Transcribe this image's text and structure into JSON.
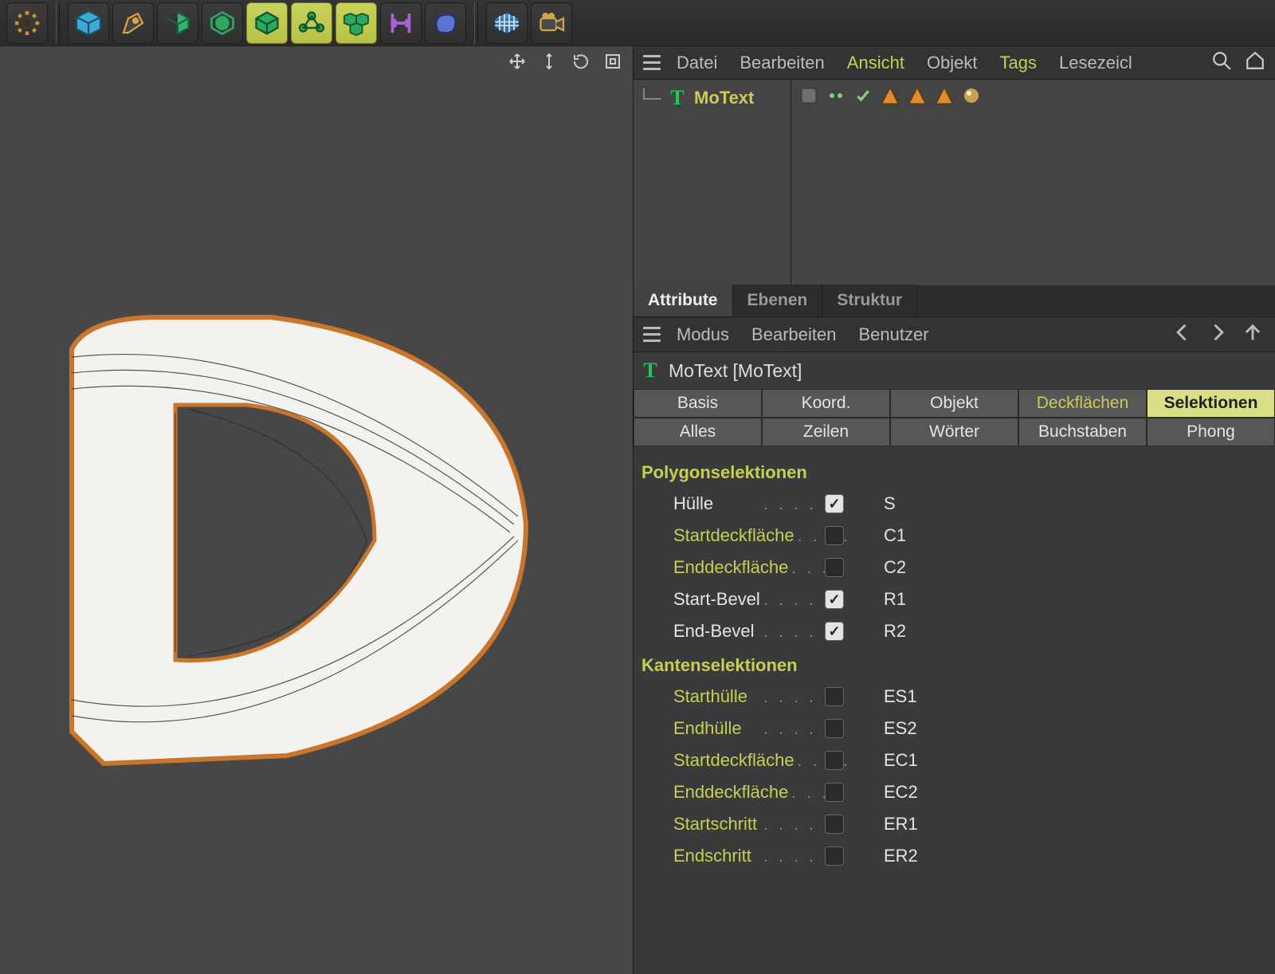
{
  "toolbar_icons": [
    {
      "name": "settings-icon"
    },
    {
      "sep": true
    },
    {
      "name": "cube-icon"
    },
    {
      "name": "pen-icon"
    },
    {
      "name": "spline-wrap-icon"
    },
    {
      "name": "subdiv-cage-icon",
      "sel": false
    },
    {
      "name": "poly-cube-icon",
      "sel": true
    },
    {
      "name": "molecule-icon",
      "sel": true
    },
    {
      "name": "cubes-group-icon",
      "sel": true
    },
    {
      "name": "measure-icon"
    },
    {
      "name": "soft-shape-icon"
    },
    {
      "sep": true
    },
    {
      "name": "grid-icon"
    },
    {
      "name": "camera-icon"
    }
  ],
  "viewport_controls": [
    {
      "name": "move-view-icon"
    },
    {
      "name": "zoom-view-icon"
    },
    {
      "name": "rotate-view-icon"
    },
    {
      "name": "frame-view-icon"
    }
  ],
  "om_menu": [
    {
      "label": "Datei"
    },
    {
      "label": "Bearbeiten"
    },
    {
      "label": "Ansicht",
      "active": true
    },
    {
      "label": "Objekt"
    },
    {
      "label": "Tags",
      "active": true
    },
    {
      "label": "Lesezeicl"
    }
  ],
  "om_object": {
    "name": "MoText"
  },
  "panel_tabs": [
    {
      "label": "Attribute",
      "on": true
    },
    {
      "label": "Ebenen"
    },
    {
      "label": "Struktur"
    }
  ],
  "attr_menu": [
    {
      "label": "Modus"
    },
    {
      "label": "Bearbeiten"
    },
    {
      "label": "Benutzer"
    }
  ],
  "object_title": "MoText [MoText]",
  "attr_tabs_row1": [
    {
      "label": "Basis"
    },
    {
      "label": "Koord."
    },
    {
      "label": "Objekt"
    },
    {
      "label": "Deckflächen",
      "hl": true
    },
    {
      "label": "Selektionen",
      "sel": true
    }
  ],
  "attr_tabs_row2": [
    {
      "label": "Alles"
    },
    {
      "label": "Zeilen"
    },
    {
      "label": "Wörter"
    },
    {
      "label": "Buchstaben"
    },
    {
      "label": "Phong"
    }
  ],
  "groups": [
    {
      "title": "Polygonselektionen",
      "rows": [
        {
          "label": "Hülle",
          "white": true,
          "checked": true,
          "val": "S"
        },
        {
          "label": "Startdeckfläche",
          "checked": false,
          "val": "C1"
        },
        {
          "label": "Enddeckfläche",
          "checked": false,
          "val": "C2"
        },
        {
          "label": "Start-Bevel",
          "white": true,
          "checked": true,
          "val": "R1"
        },
        {
          "label": "End-Bevel",
          "white": true,
          "checked": true,
          "val": "R2"
        }
      ]
    },
    {
      "title": "Kantenselektionen",
      "rows": [
        {
          "label": "Starthülle",
          "checked": false,
          "val": "ES1"
        },
        {
          "label": "Endhülle",
          "checked": false,
          "val": "ES2"
        },
        {
          "label": "Startdeckfläche",
          "checked": false,
          "val": "EC1"
        },
        {
          "label": "Enddeckfläche",
          "checked": false,
          "val": "EC2"
        },
        {
          "label": "Startschritt",
          "checked": false,
          "val": "ER1"
        },
        {
          "label": "Endschritt",
          "checked": false,
          "val": "ER2"
        }
      ]
    }
  ]
}
